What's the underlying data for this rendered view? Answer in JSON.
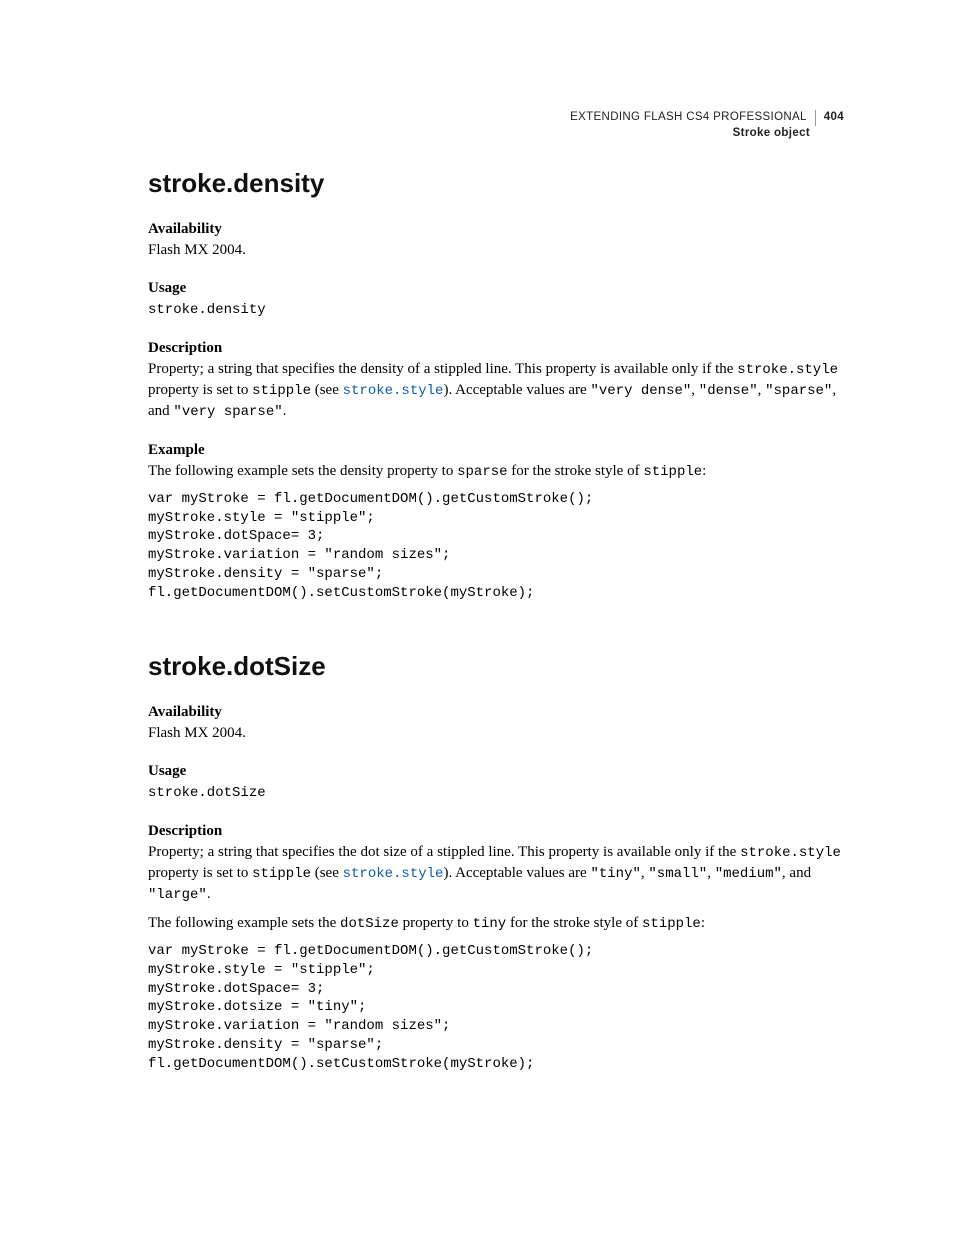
{
  "header": {
    "book_title": "EXTENDING FLASH CS4 PROFESSIONAL",
    "page_number": "404",
    "chapter": "Stroke object"
  },
  "sections": [
    {
      "title": "stroke.density",
      "availability": {
        "heading": "Availability",
        "text": "Flash MX 2004."
      },
      "usage": {
        "heading": "Usage",
        "code": "stroke.density"
      },
      "description": {
        "heading": "Description",
        "pre1": "Property; a string that specifies the density of a stippled line. This property is available only if the ",
        "code1": "stroke.style",
        "mid1": " property is set to ",
        "code2": "stipple",
        "mid2": " (see ",
        "link": "stroke.style",
        "mid3": "). Acceptable values are ",
        "v1": "\"very dense\"",
        "c1": ", ",
        "v2": "\"dense\"",
        "c2": ", ",
        "v3": "\"sparse\"",
        "c3": ", and ",
        "v4": "\"very sparse\"",
        "end": "."
      },
      "example": {
        "heading": "Example",
        "intro_pre": "The following example sets the density property to ",
        "intro_code1": "sparse",
        "intro_mid": " for the stroke style of ",
        "intro_code2": "stipple",
        "intro_end": ":",
        "code": "var myStroke = fl.getDocumentDOM().getCustomStroke();\nmyStroke.style = \"stipple\";\nmyStroke.dotSpace= 3;\nmyStroke.variation = \"random sizes\";\nmyStroke.density = \"sparse\";\nfl.getDocumentDOM().setCustomStroke(myStroke);"
      }
    },
    {
      "title": "stroke.dotSize",
      "availability": {
        "heading": "Availability",
        "text": "Flash MX 2004."
      },
      "usage": {
        "heading": "Usage",
        "code": "stroke.dotSize"
      },
      "description": {
        "heading": "Description",
        "pre1": "Property; a string that specifies the dot size of a stippled line. This property is available only if the ",
        "code1": "stroke.style",
        "mid1": " property is set to ",
        "code2": "stipple",
        "mid2": " (see ",
        "link": "stroke.style",
        "mid3": "). Acceptable values are ",
        "v1": "\"tiny\"",
        "c1": ", ",
        "v2": "\"small\"",
        "c2": ", ",
        "v3": "\"medium\"",
        "c3": ", and ",
        "v4": "\"large\"",
        "end": "."
      },
      "example": {
        "intro_pre": "The following example sets the ",
        "intro_code0": "dotSize",
        "intro_mid0": " property to ",
        "intro_code1": "tiny",
        "intro_mid": " for the stroke style of ",
        "intro_code2": "stipple",
        "intro_end": ":",
        "code": "var myStroke = fl.getDocumentDOM().getCustomStroke();\nmyStroke.style = \"stipple\";\nmyStroke.dotSpace= 3;\nmyStroke.dotsize = \"tiny\";\nmyStroke.variation = \"random sizes\";\nmyStroke.density = \"sparse\";\nfl.getDocumentDOM().setCustomStroke(myStroke);"
      }
    }
  ]
}
